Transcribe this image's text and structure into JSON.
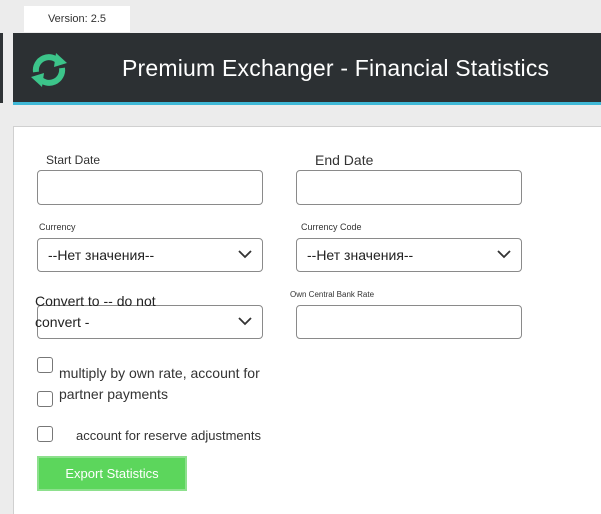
{
  "version": "Version: 2.5",
  "header": {
    "title": "Premium Exchanger - Financial Statistics",
    "logo_icon": "refresh-arrows-icon",
    "accent_color": "#3fb8d6",
    "logo_color": "#3cc48a"
  },
  "form": {
    "start_date": {
      "label": "Start Date",
      "value": ""
    },
    "end_date": {
      "label": "End Date",
      "value": ""
    },
    "currency": {
      "label": "Currency",
      "selected": "--Нет значения--"
    },
    "currency_code": {
      "label": "Currency Code",
      "selected": "--Нет значения--"
    },
    "convert_to": {
      "label": "Convert to -- do not convert -"
    },
    "own_rate": {
      "label": "Own Central Bank Rate",
      "value": ""
    },
    "checkbox_multiply": {
      "label": "multiply by own rate, account for partner payments",
      "checked": false
    },
    "checkbox_partner": {
      "checked": false
    },
    "checkbox_reserve": {
      "label": "account for reserve adjustments",
      "checked": false
    },
    "export_button": {
      "label": "Export Statistics",
      "color": "#5cd65c"
    }
  }
}
